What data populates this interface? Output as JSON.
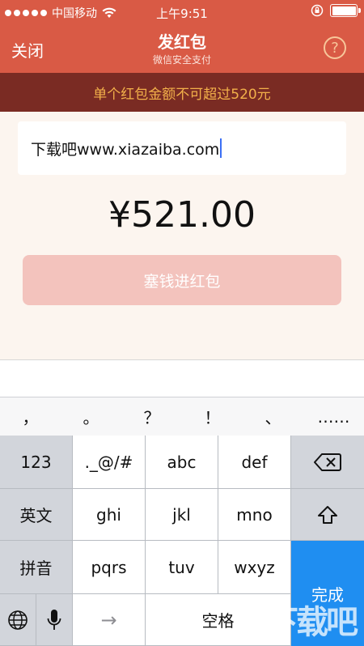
{
  "status_bar": {
    "carrier": "中国移动",
    "time": "上午9:51"
  },
  "nav": {
    "close_label": "关闭",
    "title": "发红包",
    "subtitle": "微信安全支付",
    "help_label": "?"
  },
  "warning_text": "单个红包金额不可超过520元",
  "message_input": {
    "value": "下载吧www.xiazaiba.com"
  },
  "amount": "¥521.00",
  "submit_button": "塞钱进红包",
  "keyboard": {
    "candidates": [
      "，",
      "。",
      "？",
      "！",
      "、",
      "……"
    ],
    "row1": [
      "123",
      "._@/#",
      "abc",
      "def"
    ],
    "row2": [
      "英文",
      "ghi",
      "jkl",
      "mno"
    ],
    "row3": [
      "拼音",
      "pqrs",
      "tuv",
      "wxyz"
    ],
    "arrow": "→",
    "space": "空格",
    "done": "完成"
  },
  "watermark": "下载吧",
  "colors": {
    "nav_bg": "#d95a45",
    "warning_bg": "#7a2b23",
    "warning_text": "#f2b04a",
    "button_bg": "#f3c3bd",
    "done_key": "#1f8ef1"
  }
}
